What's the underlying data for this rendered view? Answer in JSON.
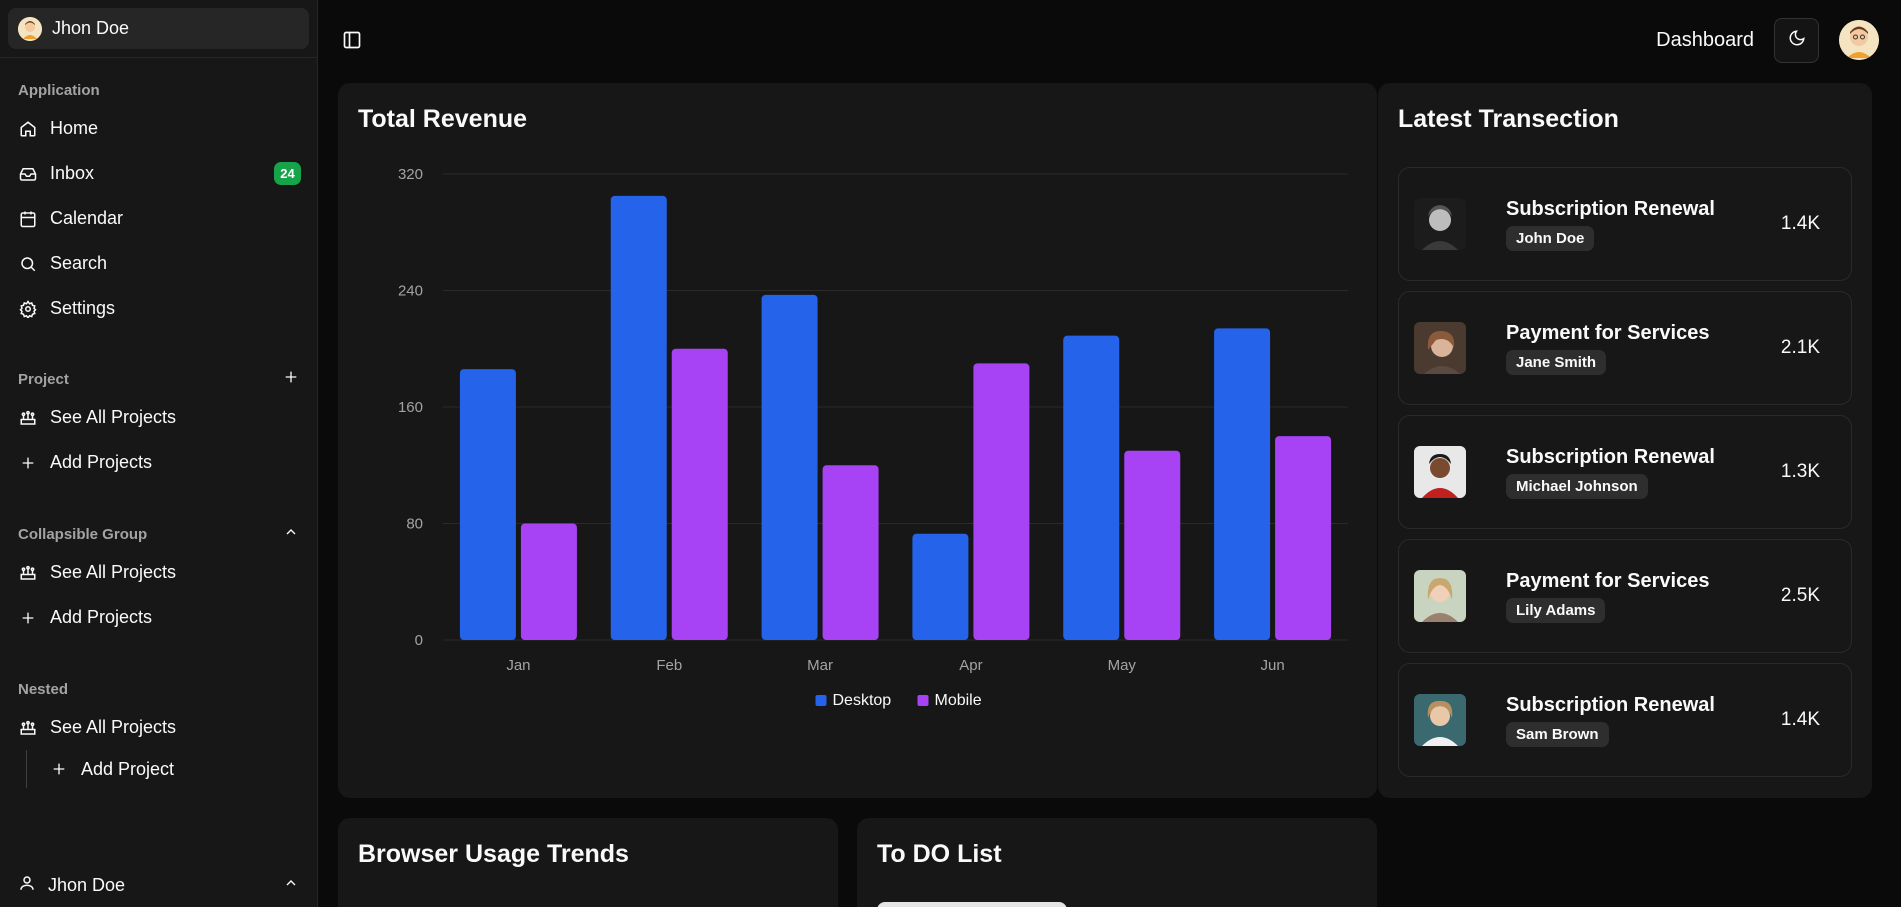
{
  "sidebar": {
    "user_name": "Jhon Doe",
    "application": {
      "label": "Application",
      "items": [
        {
          "label": "Home",
          "icon": "home-icon"
        },
        {
          "label": "Inbox",
          "icon": "inbox-icon",
          "badge": "24"
        },
        {
          "label": "Calendar",
          "icon": "calendar-icon"
        },
        {
          "label": "Search",
          "icon": "search-icon"
        },
        {
          "label": "Settings",
          "icon": "gear-icon"
        }
      ]
    },
    "project": {
      "label": "Project",
      "items": [
        {
          "label": "See All Projects",
          "icon": "projects-icon"
        },
        {
          "label": "Add Projects",
          "icon": "plus-icon"
        }
      ]
    },
    "collapsible": {
      "label": "Collapsible Group",
      "items": [
        {
          "label": "See All Projects",
          "icon": "projects-icon"
        },
        {
          "label": "Add Projects",
          "icon": "plus-icon"
        }
      ]
    },
    "nested": {
      "label": "Nested",
      "items": [
        {
          "label": "See All Projects",
          "icon": "projects-icon"
        }
      ],
      "sub_items": [
        {
          "label": "Add Project",
          "icon": "plus-icon"
        }
      ]
    },
    "footer_user": "Jhon Doe"
  },
  "header": {
    "title": "Dashboard"
  },
  "revenue": {
    "title": "Total Revenue"
  },
  "chart_data": {
    "type": "bar",
    "categories": [
      "Jan",
      "Feb",
      "Mar",
      "Apr",
      "May",
      "Jun"
    ],
    "series": [
      {
        "name": "Desktop",
        "values": [
          186,
          305,
          237,
          73,
          209,
          214
        ],
        "color": "#2563eb"
      },
      {
        "name": "Mobile",
        "values": [
          80,
          200,
          120,
          190,
          130,
          140
        ],
        "color": "#a742f5"
      }
    ],
    "yticks": [
      0,
      80,
      160,
      240,
      320
    ],
    "ylim": [
      0,
      320
    ],
    "grid": true,
    "legend": "bottom"
  },
  "transactions": {
    "title": "Latest Transection",
    "items": [
      {
        "title": "Subscription Renewal",
        "name": "John Doe",
        "amount": "1.4K"
      },
      {
        "title": "Payment for Services",
        "name": "Jane Smith",
        "amount": "2.1K"
      },
      {
        "title": "Subscription Renewal",
        "name": "Michael Johnson",
        "amount": "1.3K"
      },
      {
        "title": "Payment for Services",
        "name": "Lily Adams",
        "amount": "2.5K"
      },
      {
        "title": "Subscription Renewal",
        "name": "Sam Brown",
        "amount": "1.4K"
      }
    ]
  },
  "browser": {
    "title": "Browser Usage Trends"
  },
  "todo": {
    "title": "To DO List"
  }
}
